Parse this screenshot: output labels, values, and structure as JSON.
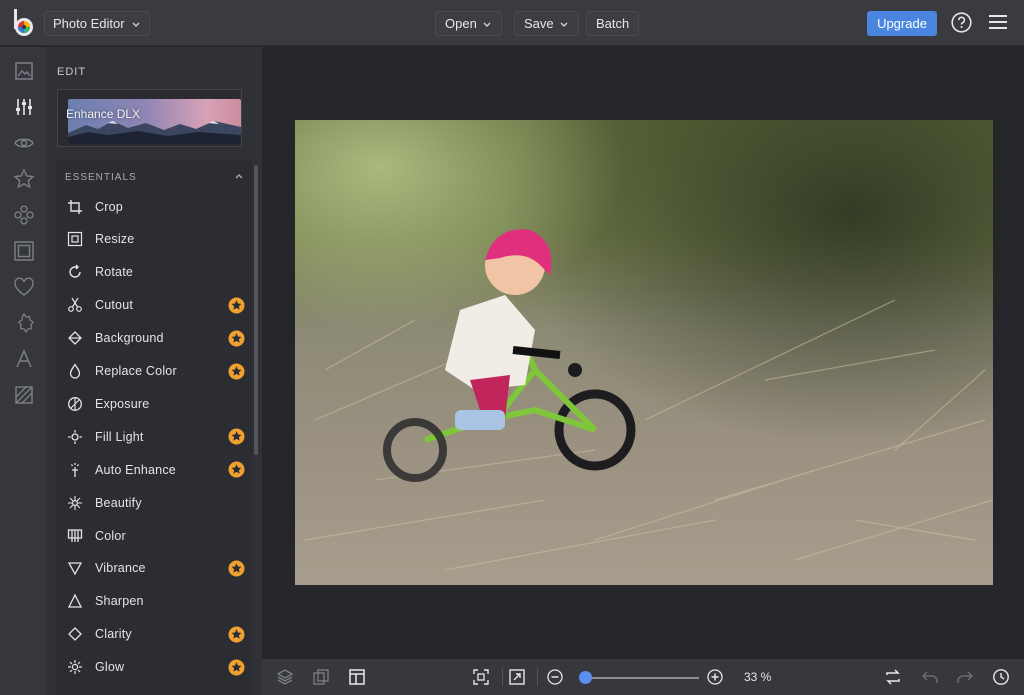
{
  "topbar": {
    "app_name": "Photo Editor",
    "open_label": "Open",
    "save_label": "Save",
    "batch_label": "Batch",
    "upgrade_label": "Upgrade",
    "accent": "#4a86e0"
  },
  "rail": {
    "icons": [
      "image-icon",
      "sliders-icon",
      "eye-icon",
      "star-icon",
      "effects-icon",
      "frame-icon",
      "heart-icon",
      "badge-icon",
      "text-icon",
      "texture-icon"
    ],
    "active": "sliders-icon"
  },
  "panel": {
    "section_label": "EDIT",
    "enhance_label": "Enhance DLX",
    "essentials_label": "ESSENTIALS",
    "tools": [
      {
        "label": "Crop",
        "icon": "crop-icon",
        "premium": false
      },
      {
        "label": "Resize",
        "icon": "resize-icon",
        "premium": false
      },
      {
        "label": "Rotate",
        "icon": "rotate-icon",
        "premium": false
      },
      {
        "label": "Cutout",
        "icon": "scissors-icon",
        "premium": true
      },
      {
        "label": "Background",
        "icon": "background-icon",
        "premium": true
      },
      {
        "label": "Replace Color",
        "icon": "droplet-icon",
        "premium": true
      },
      {
        "label": "Exposure",
        "icon": "exposure-icon",
        "premium": false
      },
      {
        "label": "Fill Light",
        "icon": "sun-icon",
        "premium": true
      },
      {
        "label": "Auto Enhance",
        "icon": "wand-icon",
        "premium": true
      },
      {
        "label": "Beautify",
        "icon": "beautify-icon",
        "premium": false
      },
      {
        "label": "Color",
        "icon": "color-icon",
        "premium": false
      },
      {
        "label": "Vibrance",
        "icon": "vibrance-icon",
        "premium": true
      },
      {
        "label": "Sharpen",
        "icon": "sharpen-icon",
        "premium": false
      },
      {
        "label": "Clarity",
        "icon": "clarity-icon",
        "premium": true
      },
      {
        "label": "Glow",
        "icon": "glow-icon",
        "premium": true
      }
    ],
    "premium_color": "#f0a030"
  },
  "bottombar": {
    "zoom_value": "33 %",
    "zoom_fraction": 0.0
  }
}
